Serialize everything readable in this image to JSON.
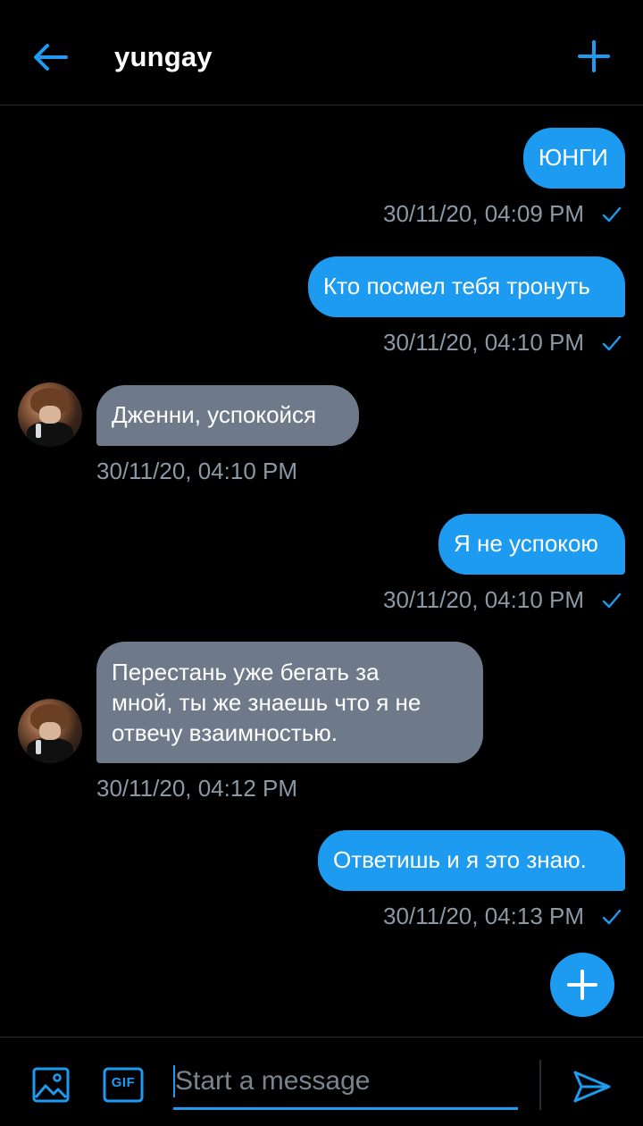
{
  "header": {
    "title": "yungay",
    "back_icon": "arrow-left-icon",
    "add_icon": "plus-icon"
  },
  "messages": [
    {
      "direction": "out",
      "text": "ЮНГИ",
      "timestamp": "30/11/20, 04:09 PM",
      "status": "sent"
    },
    {
      "direction": "out",
      "text": "Кто посмел тебя тронуть",
      "timestamp": "30/11/20, 04:10 PM",
      "status": "sent"
    },
    {
      "direction": "in",
      "text": "Дженни, успокойся",
      "timestamp": "30/11/20, 04:10 PM"
    },
    {
      "direction": "out",
      "text": "Я не успокою",
      "timestamp": "30/11/20, 04:10 PM",
      "status": "sent"
    },
    {
      "direction": "in",
      "text": "Перестань уже бегать за\nмной, ты же знаешь что я не\nотвечу взаимностью.",
      "timestamp": "30/11/20, 04:12 PM"
    },
    {
      "direction": "out",
      "text": "Ответишь и я это знаю.",
      "timestamp": "30/11/20, 04:13 PM",
      "status": "sent"
    }
  ],
  "composer": {
    "placeholder": "Start a message",
    "value": "",
    "image_icon": "image-icon",
    "gif_label": "GIF",
    "send_icon": "send-icon"
  },
  "fab": {
    "icon": "plus-icon"
  },
  "colors": {
    "accent": "#1d9bf0",
    "incoming_bubble": "#6e7a89",
    "timestamp": "#8b98a5",
    "background": "#000000"
  }
}
